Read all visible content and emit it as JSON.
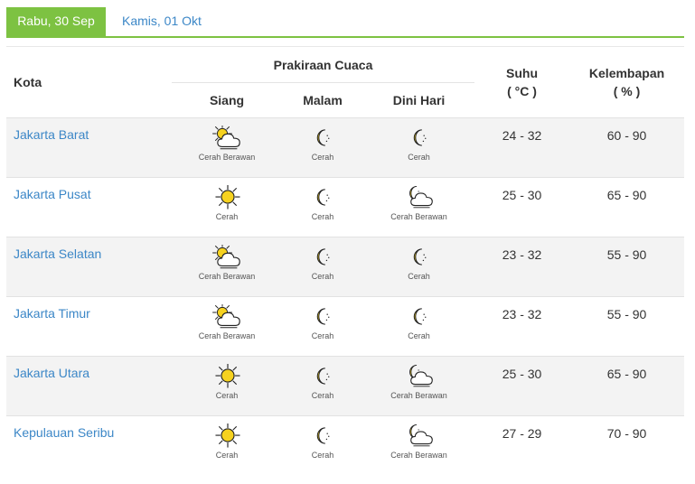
{
  "tabs": [
    {
      "label": "Rabu, 30 Sep",
      "active": true
    },
    {
      "label": "Kamis, 01 Okt",
      "active": false
    }
  ],
  "headers": {
    "kota": "Kota",
    "prakiraan": "Prakiraan Cuaca",
    "siang": "Siang",
    "malam": "Malam",
    "dini_hari": "Dini Hari",
    "suhu": "Suhu",
    "suhu_unit": "( °C )",
    "kelembapan": "Kelembapan",
    "kelembapan_unit": "( % )"
  },
  "colors": {
    "accent_green": "#7dc242",
    "link_blue": "#3c87c7"
  },
  "rows": [
    {
      "city": "Jakarta Barat",
      "siang": {
        "icon": "sun-cloud-icon",
        "label": "Cerah Berawan"
      },
      "malam": {
        "icon": "moon-icon",
        "label": "Cerah"
      },
      "dini": {
        "icon": "moon-icon",
        "label": "Cerah"
      },
      "suhu": "24 - 32",
      "kelembapan": "60 - 90"
    },
    {
      "city": "Jakarta Pusat",
      "siang": {
        "icon": "sun-icon",
        "label": "Cerah"
      },
      "malam": {
        "icon": "moon-icon",
        "label": "Cerah"
      },
      "dini": {
        "icon": "moon-cloud-icon",
        "label": "Cerah Berawan"
      },
      "suhu": "25 - 30",
      "kelembapan": "65 - 90"
    },
    {
      "city": "Jakarta Selatan",
      "siang": {
        "icon": "sun-cloud-icon",
        "label": "Cerah Berawan"
      },
      "malam": {
        "icon": "moon-icon",
        "label": "Cerah"
      },
      "dini": {
        "icon": "moon-icon",
        "label": "Cerah"
      },
      "suhu": "23 - 32",
      "kelembapan": "55 - 90"
    },
    {
      "city": "Jakarta Timur",
      "siang": {
        "icon": "sun-cloud-icon",
        "label": "Cerah Berawan"
      },
      "malam": {
        "icon": "moon-icon",
        "label": "Cerah"
      },
      "dini": {
        "icon": "moon-icon",
        "label": "Cerah"
      },
      "suhu": "23 - 32",
      "kelembapan": "55 - 90"
    },
    {
      "city": "Jakarta Utara",
      "siang": {
        "icon": "sun-icon",
        "label": "Cerah"
      },
      "malam": {
        "icon": "moon-icon",
        "label": "Cerah"
      },
      "dini": {
        "icon": "moon-cloud-icon",
        "label": "Cerah Berawan"
      },
      "suhu": "25 - 30",
      "kelembapan": "65 - 90"
    },
    {
      "city": "Kepulauan Seribu",
      "siang": {
        "icon": "sun-icon",
        "label": "Cerah"
      },
      "malam": {
        "icon": "moon-icon",
        "label": "Cerah"
      },
      "dini": {
        "icon": "moon-cloud-icon",
        "label": "Cerah Berawan"
      },
      "suhu": "27 - 29",
      "kelembapan": "70 - 90"
    }
  ]
}
